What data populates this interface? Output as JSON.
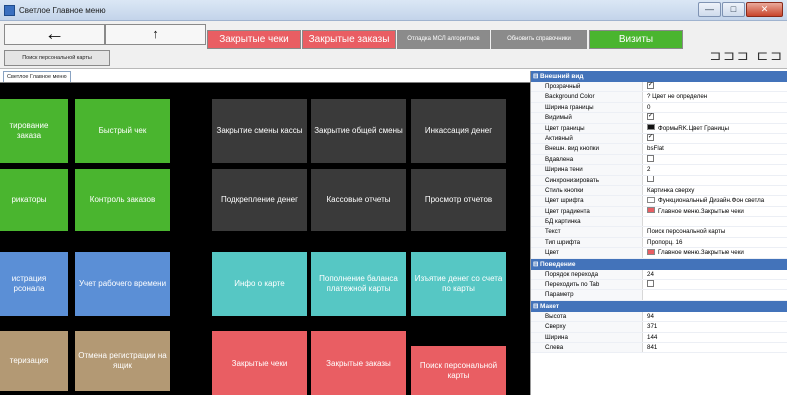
{
  "window": {
    "title": "Светлое Главное меню",
    "minimize_glyph": "—",
    "maximize_glyph": "□",
    "close_glyph": "✕"
  },
  "toolbar": {
    "back_glyph": "←",
    "up_glyph": "↑",
    "closed_checks_label": "Закрытые чеки",
    "closed_orders_label": "Закрытые заказы",
    "mcl_label": "Отладка МСЛ алгоритмов",
    "update_label": "Обновить справочники",
    "visits_label": "Визиты",
    "search_card_label": "Поиск персональной карты",
    "layout_glyphs": "⊐⊐⊐ ⊏⊐ ⊐⊐"
  },
  "tab": {
    "label": "Светлое Главное меню"
  },
  "colors": {
    "green": "#4ab52f",
    "dark": "#3a3a3a",
    "blue": "#5b8fd6",
    "teal": "#56c7c4",
    "tan": "#b39974",
    "red": "#e95e63",
    "category": "#4373ba"
  },
  "tiles": [
    {
      "id": "tile-reports",
      "text": "тирование\nзаказа",
      "color": "green"
    },
    {
      "id": "tile-quick-check",
      "text": "Быстрый чек",
      "color": "green"
    },
    {
      "id": "tile-close-shift",
      "text": "Закрытие смены кассы",
      "color": "dark"
    },
    {
      "id": "tile-close-total-shift",
      "text": "Закрытие общей смены",
      "color": "dark"
    },
    {
      "id": "tile-encashment",
      "text": "Инкассация денег",
      "color": "dark"
    },
    {
      "id": "tile-modifiers",
      "text": "рикаторы",
      "color": "green"
    },
    {
      "id": "tile-order-control",
      "text": "Контроль заказов",
      "color": "green"
    },
    {
      "id": "tile-cash-reinforce",
      "text": "Подкрепление денег",
      "color": "dark"
    },
    {
      "id": "tile-cash-reports",
      "text": "Кассовые отчеты",
      "color": "dark"
    },
    {
      "id": "tile-view-reports",
      "text": "Просмотр отчетов",
      "color": "dark"
    },
    {
      "id": "tile-staff-registration",
      "text": "истрация\nрсонала",
      "color": "blue"
    },
    {
      "id": "tile-working-time",
      "text": "Учет рабочего времени",
      "color": "blue"
    },
    {
      "id": "tile-card-info",
      "text": "Инфо о карте",
      "color": "teal"
    },
    {
      "id": "tile-card-topup",
      "text": "Пополнение баланса платежной карты",
      "color": "teal"
    },
    {
      "id": "tile-card-withdraw",
      "text": "Изъятие денег со счета по карты",
      "color": "teal"
    },
    {
      "id": "tile-authorization",
      "text": "теризация",
      "color": "tan"
    },
    {
      "id": "tile-cancel-registration",
      "text": "Отмена регистрации на ящик",
      "color": "tan"
    },
    {
      "id": "tile-closed-checks",
      "text": "Закрытые чеки",
      "color": "red"
    },
    {
      "id": "tile-closed-orders",
      "text": "Закрытые заказы",
      "color": "red"
    },
    {
      "id": "tile-search-card",
      "text": "Поиск персональной карты",
      "color": "red"
    }
  ],
  "properties": [
    {
      "category": "Внешний вид",
      "rows": [
        {
          "key": "Прозрачный",
          "value": "",
          "check": "✓"
        },
        {
          "key": "Background Color",
          "value": "Цвет не определен",
          "prefix": "?"
        },
        {
          "key": "Ширина границы",
          "value": "0"
        },
        {
          "key": "Видимый",
          "value": "",
          "check": "✓"
        },
        {
          "key": "Цвет границы",
          "value": "ФормыRK.Цвет Границы",
          "swatch": "#111111"
        },
        {
          "key": "Активный",
          "value": "",
          "check": "✓"
        },
        {
          "key": "Внешн. вид кнопки",
          "value": "bsFlat"
        },
        {
          "key": "Вдавлена",
          "value": "",
          "check": ""
        },
        {
          "key": "Ширина тени",
          "value": "2"
        },
        {
          "key": "Синхронизировать",
          "value": "",
          "check": ""
        },
        {
          "key": "Стиль кнопки",
          "value": "Картинка сверху"
        },
        {
          "key": "Цвет шрифта",
          "value": "Функциональный Дизайн.Фон светла",
          "swatch": "#ffffff"
        },
        {
          "key": "Цвет градиента",
          "value": "Главное меню.Закрытые чеки",
          "swatch": "#e95e63"
        },
        {
          "key": "БД картинка",
          "value": ""
        },
        {
          "key": "Текст",
          "value": "Поиск персональной карты"
        },
        {
          "key": "Тип шрифта",
          "value": "Пропорц. 16"
        },
        {
          "key": "Цвет",
          "value": "Главное меню.Закрытые чеки",
          "swatch": "#e95e63"
        }
      ]
    },
    {
      "category": "Поведение",
      "rows": [
        {
          "key": "Порядок перехода",
          "value": "24"
        },
        {
          "key": "Переходить по Tab",
          "value": "",
          "check": ""
        },
        {
          "key": "Параметр",
          "value": ""
        }
      ]
    },
    {
      "category": "Макет",
      "rows": [
        {
          "key": "Высота",
          "value": "94"
        },
        {
          "key": "Сверху",
          "value": "371"
        },
        {
          "key": "Ширина",
          "value": "144"
        },
        {
          "key": "Слева",
          "value": "841"
        }
      ]
    }
  ]
}
